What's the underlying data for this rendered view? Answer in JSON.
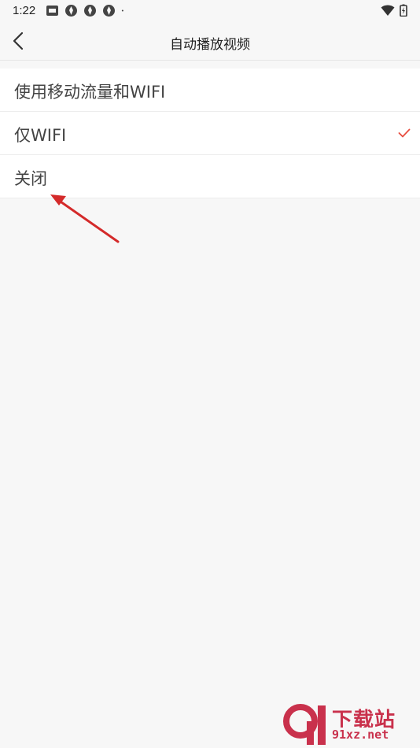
{
  "status_bar": {
    "time": "1:22"
  },
  "nav": {
    "title": "自动播放视频"
  },
  "options": [
    {
      "label": "使用移动流量和WIFI",
      "selected": false
    },
    {
      "label": "仅WIFI",
      "selected": true
    },
    {
      "label": "关闭",
      "selected": false
    }
  ],
  "colors": {
    "accent": "#e84e40",
    "arrow": "#d42a2a",
    "watermark": "#c9314c",
    "background": "#f7f7f7"
  },
  "watermark": {
    "logo_text": "下载站",
    "url_text": "91xz.net"
  }
}
